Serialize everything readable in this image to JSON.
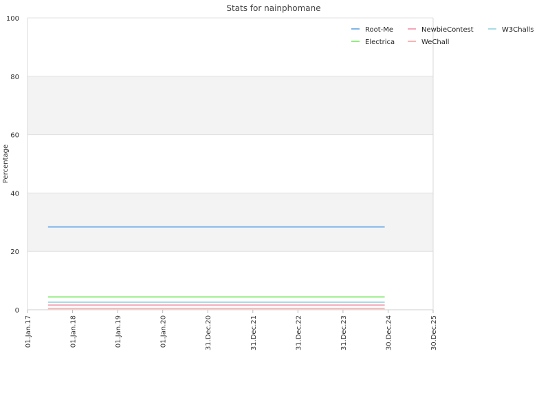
{
  "chart_data": {
    "type": "line",
    "title": "Stats for nainphomane",
    "xlabel": "",
    "ylabel": "Percentage",
    "ylim": [
      0,
      100
    ],
    "xlim": [
      "2017-01-01",
      "2025-12-30"
    ],
    "x_ticks": [
      "01.Jan.17",
      "01.Jan.18",
      "01.Jan.19",
      "01.Jan.20",
      "31.Dec.20",
      "31.Dec.21",
      "31.Dec.22",
      "31.Dec.23",
      "30.Dec.24",
      "30.Dec.25"
    ],
    "y_ticks": [
      "0",
      "20",
      "40",
      "60",
      "80",
      "100"
    ],
    "y_tick_values": [
      0,
      20,
      40,
      60,
      80,
      100
    ],
    "grid": true,
    "legend_position": "top-right",
    "x": [
      "2017-06-16",
      "2024-12-03"
    ],
    "series": [
      {
        "name": "Root-Me",
        "values": [
          28.4,
          28.4
        ],
        "color": "#7cb5ec"
      },
      {
        "name": "NewbieContest",
        "values": [
          1.6,
          1.6
        ],
        "color": "#f4a6b8"
      },
      {
        "name": "W3Challs",
        "values": [
          2.6,
          2.6
        ],
        "color": "#a8dbe8"
      },
      {
        "name": "Electrica",
        "values": [
          4.4,
          4.4
        ],
        "color": "#90ed7d"
      },
      {
        "name": "WeChall",
        "values": [
          0.4,
          0.4
        ],
        "color": "#f7b5b5"
      }
    ]
  }
}
